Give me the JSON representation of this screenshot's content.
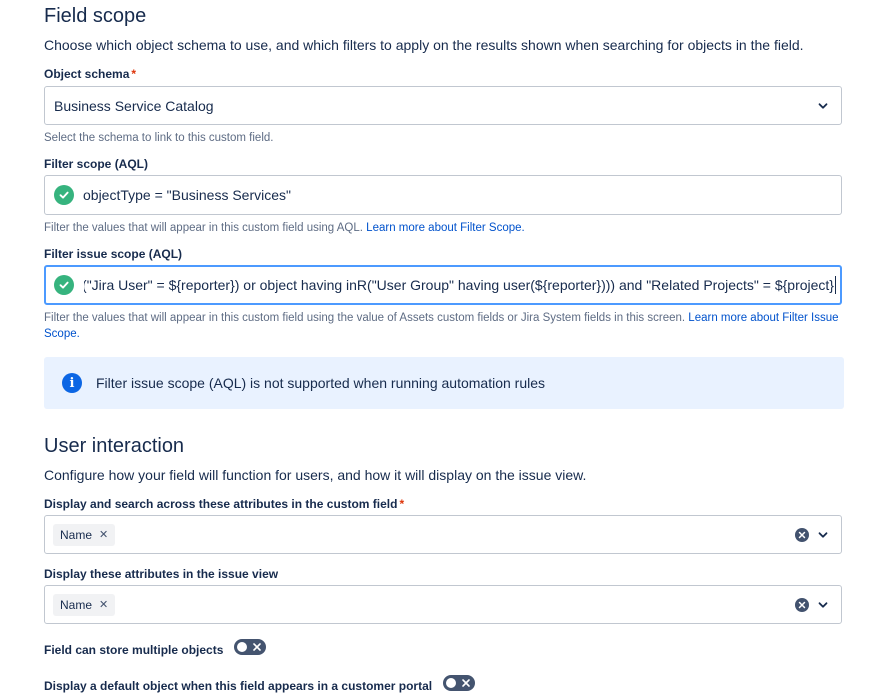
{
  "field_scope": {
    "title": "Field scope",
    "description": "Choose which object schema to use, and which filters to apply on the results shown when searching for objects in the field.",
    "object_schema": {
      "label": "Object schema",
      "required_marker": "*",
      "value": "Business Service Catalog",
      "help": "Select the schema to link to this custom field."
    },
    "filter_scope": {
      "label": "Filter scope (AQL)",
      "value": "objectType = \"Business Services\"",
      "help": "Filter the values that will appear in this custom field using AQL. ",
      "help_link": "Learn more about Filter Scope."
    },
    "filter_issue_scope": {
      "label": "Filter issue scope (AQL)",
      "value": "iR(\"Jira User\" = ${reporter}) or object having inR(\"User Group\" having user(${reporter}))) and \"Related Projects\" = ${project}",
      "help": "Filter the values that will appear in this custom field using the value of Assets custom fields or Jira System fields in this screen. ",
      "help_link": "Learn more about Filter Issue Scope."
    },
    "info_message": "Filter issue scope (AQL) is not supported when running automation rules"
  },
  "user_interaction": {
    "title": "User interaction",
    "description": "Configure how your field will function for users, and how it will display on the issue view.",
    "search_attributes": {
      "label": "Display and search across these attributes in the custom field",
      "required_marker": "*",
      "tags": [
        "Name"
      ]
    },
    "issue_view_attributes": {
      "label": "Display these attributes in the issue view",
      "tags": [
        "Name"
      ]
    },
    "multiple_objects": {
      "label": "Field can store multiple objects",
      "enabled": false
    },
    "default_object_portal": {
      "label": "Display a default object when this field appears in a customer portal",
      "enabled": false
    }
  },
  "colors": {
    "success": "#36b37e",
    "info_bg": "#e9f2ff",
    "info_icon": "#0c66e4",
    "focus_border": "#4c9aff",
    "link": "#0052cc",
    "required": "#de350b"
  }
}
